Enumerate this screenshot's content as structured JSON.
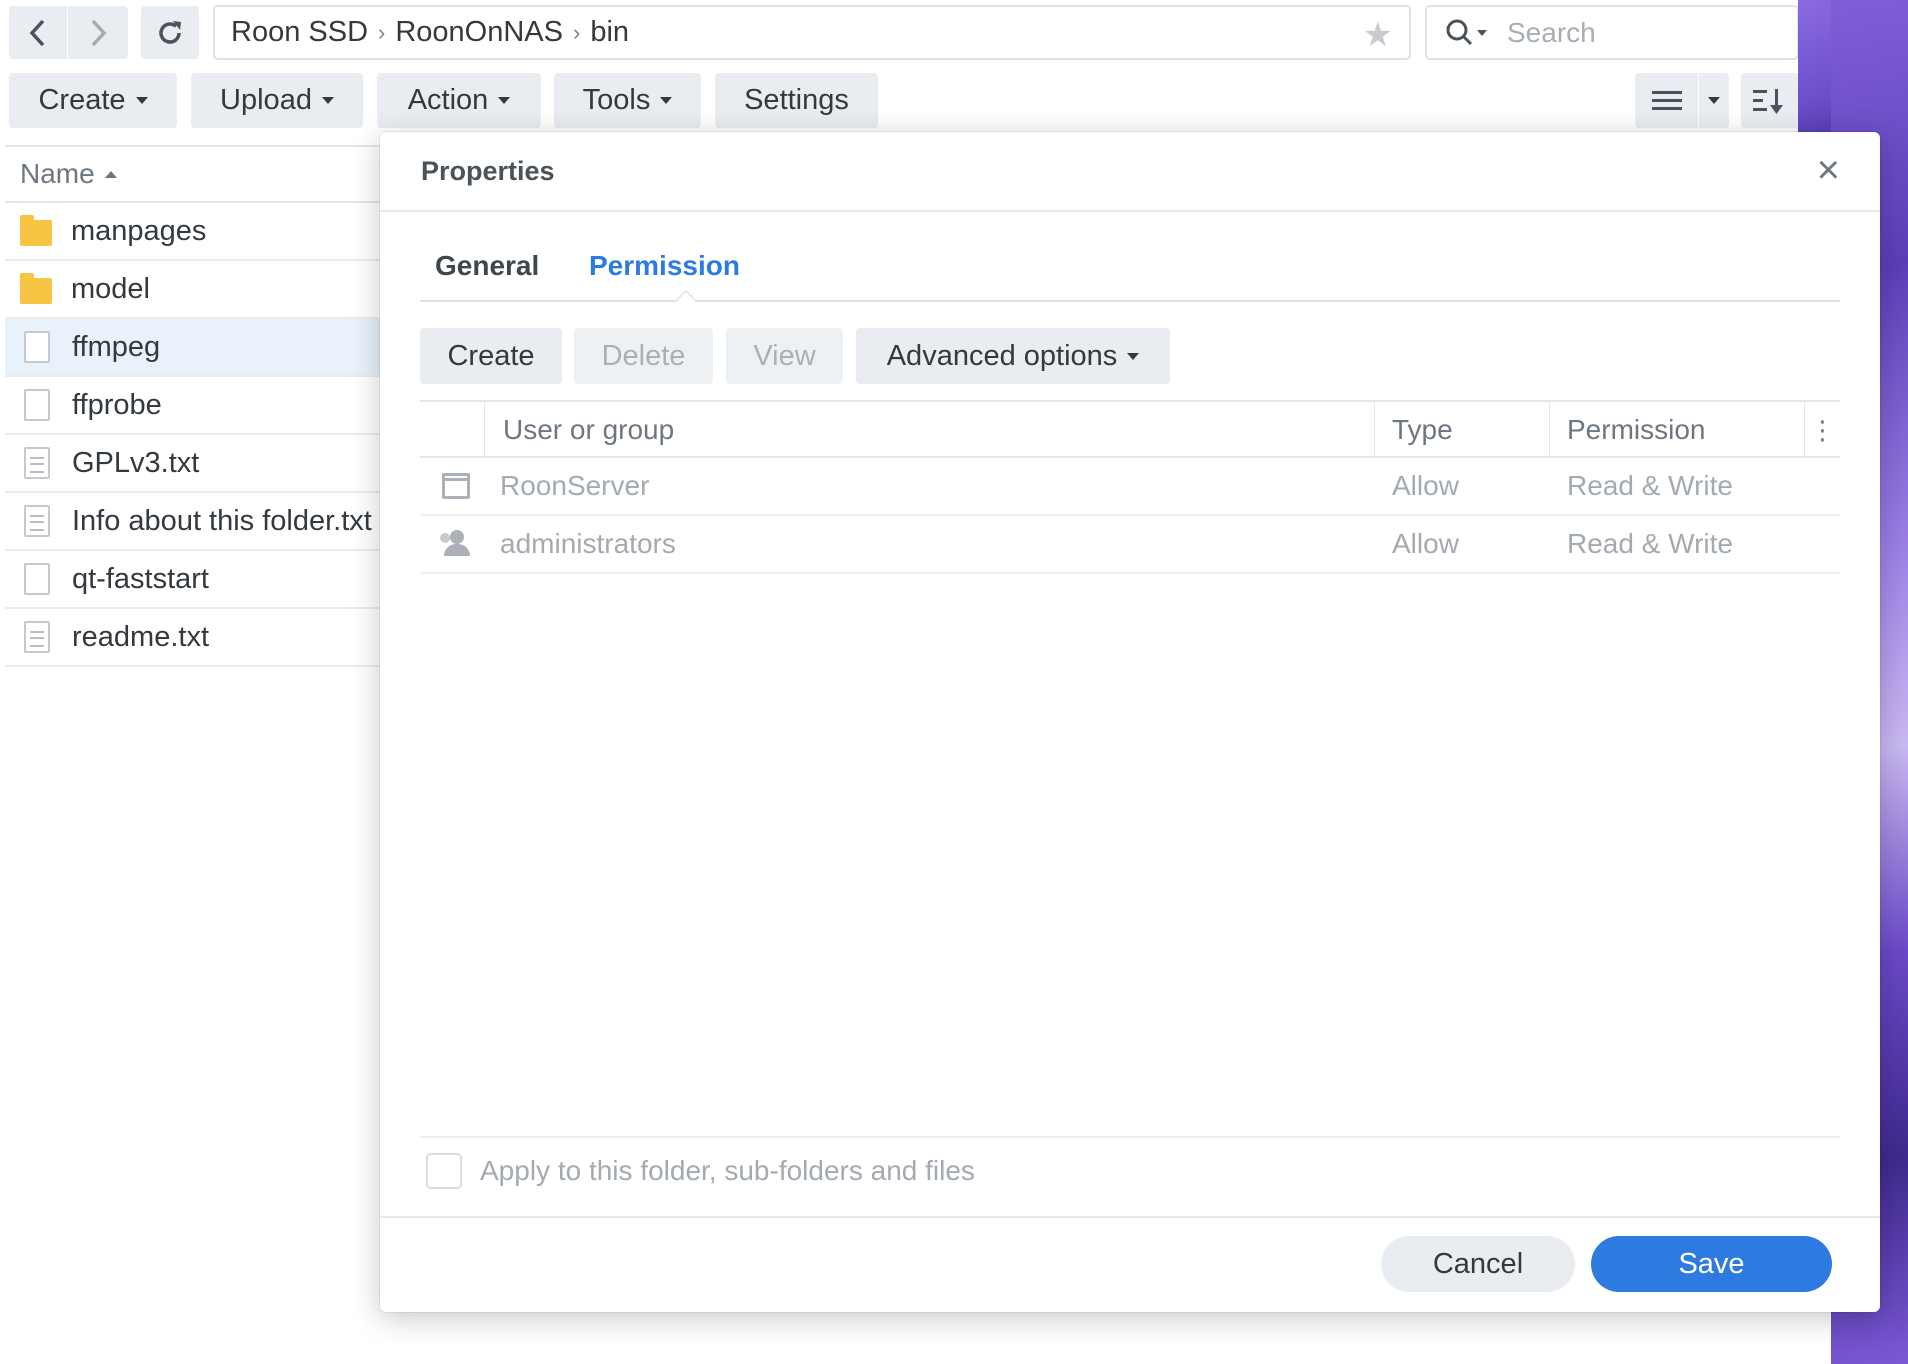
{
  "toolbar": {
    "path": [
      "Roon SSD",
      "RoonOnNAS",
      "bin"
    ],
    "search_placeholder": "Search",
    "create": "Create",
    "upload": "Upload",
    "action": "Action",
    "tools": "Tools",
    "settings": "Settings"
  },
  "file_list": {
    "header": "Name",
    "items": [
      {
        "name": "manpages",
        "kind": "folder"
      },
      {
        "name": "model",
        "kind": "folder"
      },
      {
        "name": "ffmpeg",
        "kind": "file",
        "selected": true
      },
      {
        "name": "ffprobe",
        "kind": "file"
      },
      {
        "name": "GPLv3.txt",
        "kind": "text"
      },
      {
        "name": "Info about this folder.txt",
        "kind": "text"
      },
      {
        "name": "qt-faststart",
        "kind": "file"
      },
      {
        "name": "readme.txt",
        "kind": "text"
      }
    ]
  },
  "dialog": {
    "title": "Properties",
    "close_icon": "×",
    "tabs": {
      "general": "General",
      "permission": "Permission"
    },
    "active_tab": "Permission",
    "buttons": {
      "create": "Create",
      "delete": "Delete",
      "view": "View",
      "advanced": "Advanced options"
    },
    "grid": {
      "columns": {
        "user": "User or group",
        "type": "Type",
        "permission": "Permission"
      },
      "rows": [
        {
          "user": "RoonServer",
          "type": "Allow",
          "permission": "Read & Write",
          "icon": "user-icon"
        },
        {
          "user": "administrators",
          "type": "Allow",
          "permission": "Read & Write",
          "icon": "group-icon"
        }
      ]
    },
    "apply_label": "Apply to this folder, sub-folders and files",
    "cancel": "Cancel",
    "save": "Save"
  },
  "colors": {
    "accent": "#2d7be0",
    "button_bg": "#e9edf1",
    "folder": "#f6c544"
  }
}
